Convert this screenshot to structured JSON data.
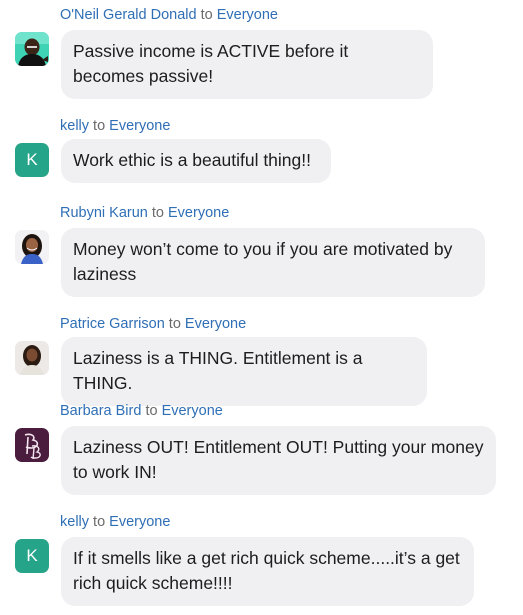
{
  "to_word": "to",
  "messages": [
    {
      "sender": "O'Neil Gerald Donald",
      "recipient": "Everyone",
      "avatar": "photo-man-icon",
      "text": "Passive income is ACTIVE before it becomes passive!"
    },
    {
      "sender": "kelly",
      "recipient": "Everyone",
      "avatar_letter": "K",
      "avatar_color": "#26a489",
      "text": "Work ethic is a beautiful thing!!"
    },
    {
      "sender": "Rubyni Karun",
      "recipient": "Everyone",
      "avatar": "photo-woman-icon",
      "text": "Money won’t come to you if you are motivated by laziness"
    },
    {
      "sender": "Patrice Garrison",
      "recipient": "Everyone",
      "avatar": "photo-woman-icon",
      "text": "Laziness is a THING. Entitlement is a THING."
    },
    {
      "sender": "Barbara Bird",
      "recipient": "Everyone",
      "avatar": "monogram-logo-icon",
      "text": "Laziness OUT! Entitlement OUT! Putting your money to work IN!"
    },
    {
      "sender": "kelly",
      "recipient": "Everyone",
      "avatar_letter": "K",
      "avatar_color": "#26a489",
      "text": "If it smells like a get rich quick scheme.....it’s a get rich quick scheme!!!!"
    }
  ]
}
